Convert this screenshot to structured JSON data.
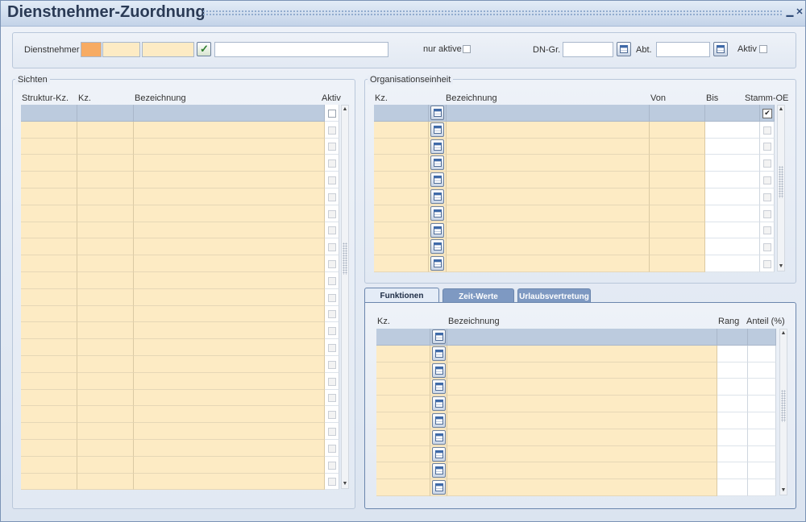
{
  "window": {
    "title": "Dienstnehmer-Zuordnung",
    "minimize_symbol": "▁",
    "close_symbol": "✕"
  },
  "header": {
    "dienstnehmer_label": "Dienstnehmer",
    "nur_aktive_label": "nur aktive",
    "dngr_label": "DN-Gr.",
    "abt_label": "Abt.",
    "aktiv_label": "Aktiv"
  },
  "sichten": {
    "legend": "Sichten",
    "columns": [
      "Struktur-Kz.",
      "Kz.",
      "Bezeichnung",
      "Aktiv"
    ],
    "row_count": 23
  },
  "org": {
    "legend": "Organisationseinheit",
    "columns": [
      "Kz.",
      "Bezeichnung",
      "Von",
      "Bis",
      "Stamm-OE"
    ],
    "row_count": 10,
    "first_row_stamm_checked": true,
    "check_symbol": "✔"
  },
  "tabs": [
    {
      "label": "Funktionen",
      "active": true
    },
    {
      "label": "Zeit-Werte",
      "active": false
    },
    {
      "label": "Urlaubsvertretung",
      "active": false
    }
  ],
  "funktionen": {
    "columns": [
      "Kz.",
      "Bezeichnung",
      "Rang",
      "Anteil (%)"
    ],
    "row_count": 10
  },
  "icons": {
    "scroll_up": "▲",
    "scroll_down": "▼"
  },
  "colors": {
    "row_fill": "#fdebc4",
    "selected_row": "#bccbde",
    "focus_field": "#f7ab63",
    "active_tab": "#e4ecf7",
    "inactive_tab": "#7e99c2"
  }
}
